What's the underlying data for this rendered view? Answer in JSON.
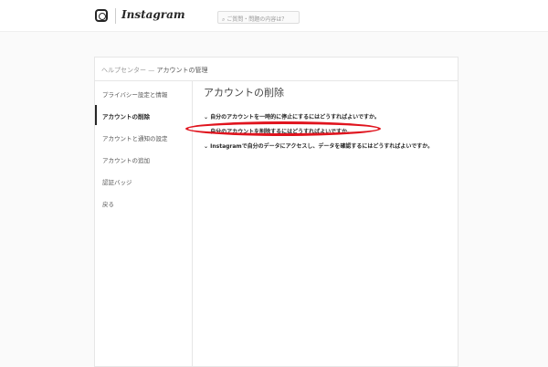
{
  "header": {
    "brand": "Instagram",
    "search_placeholder": "ご質問・問題の内容は？"
  },
  "breadcrumb": {
    "root": "ヘルプセンター",
    "separator": " — ",
    "current": "アカウントの管理"
  },
  "sidebar": {
    "items": [
      {
        "label": "プライバシー設定と情報"
      },
      {
        "label": "アカウントの削除",
        "active": true
      },
      {
        "label": "アカウントと通知の設定"
      },
      {
        "label": "アカウントの追加"
      },
      {
        "label": "認証バッジ"
      },
      {
        "label": "戻る"
      }
    ]
  },
  "main": {
    "title": "アカウントの削除",
    "questions": [
      "自分のアカウントを一時的に停止にするにはどうすればよいですか。",
      "自分のアカウントを削除するにはどうすればよいですか。",
      "Instagramで自分のデータにアクセスし、データを確認するにはどうすればよいですか。"
    ],
    "chevron": "⌄"
  },
  "colors": {
    "highlight": "#e0141e"
  }
}
